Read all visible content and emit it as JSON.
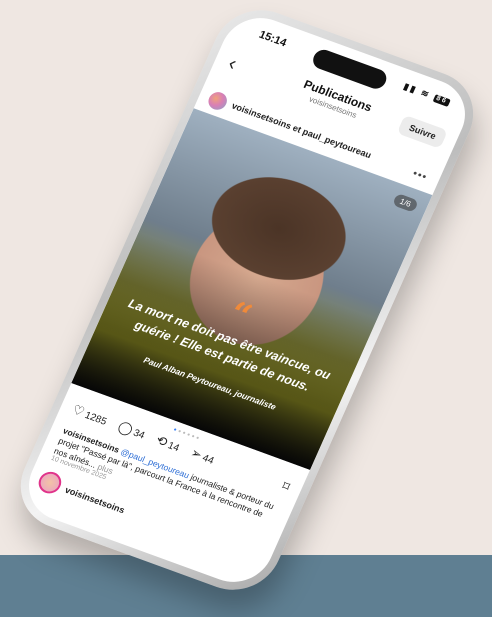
{
  "status": {
    "time": "15:14",
    "battery": "86"
  },
  "header": {
    "title": "Publications",
    "subtitle": "voisinsetsoins",
    "follow_label": "Suivre"
  },
  "post": {
    "authors": "voisinsetsoins et paul_peytoureau",
    "page_indicator": "1/6",
    "quote_mark": "“",
    "quote": "La mort ne doit pas être vaincue, ou guérie ! Elle est partie de nous.",
    "quote_author": "Paul Alban Peytoureau, journaliste",
    "likes": "1285",
    "comments": "34",
    "reposts": "14",
    "shares": "44",
    "caption_user": "voisinsetsoins",
    "caption_mention": "@paul_peytoureau",
    "caption_text": " journaliste & porteur du projet \"Passé par là\", parcourt la France à la rencontre de nos aînés...",
    "caption_more": " plus",
    "date": "10 novembre 2025"
  },
  "story": {
    "name": "voisinsetsoins"
  },
  "colors": {
    "accent_quote": "#f08a3a",
    "mention": "#2f6fd6",
    "footer": "#5f7f92",
    "background": "#efe7e2"
  }
}
